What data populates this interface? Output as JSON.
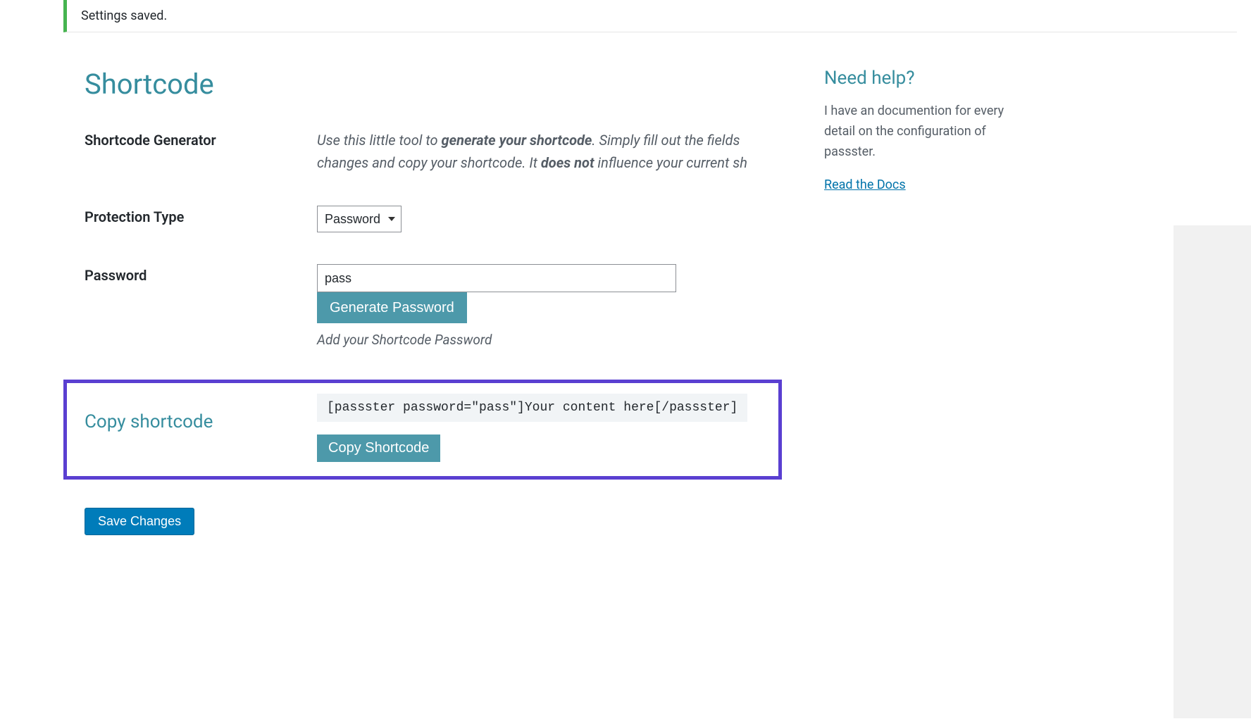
{
  "notice": "Settings saved.",
  "section_title": "Shortcode",
  "rows": {
    "generator": {
      "label": "Shortcode Generator",
      "desc_p1_pre": "Use this little tool to ",
      "desc_p1_bold": "generate your shortcode",
      "desc_p1_post": ". Simply fill out the fields",
      "desc_p2_pre": "changes and copy your shortcode. It ",
      "desc_p2_bold": "does not",
      "desc_p2_post": " influence your current sh"
    },
    "protection_type": {
      "label": "Protection Type",
      "selected": "Password"
    },
    "password": {
      "label": "Password",
      "value": "pass",
      "button": "Generate Password",
      "hint": "Add your Shortcode Password"
    },
    "copy": {
      "label": "Copy shortcode",
      "code": "[passster password=\"pass\"]Your content here[/passster]",
      "button": "Copy Shortcode"
    }
  },
  "save_button": "Save Changes",
  "help": {
    "title": "Need help?",
    "text": "I have an documention for every detail on the configuration of passster.",
    "link": "Read the Docs"
  }
}
